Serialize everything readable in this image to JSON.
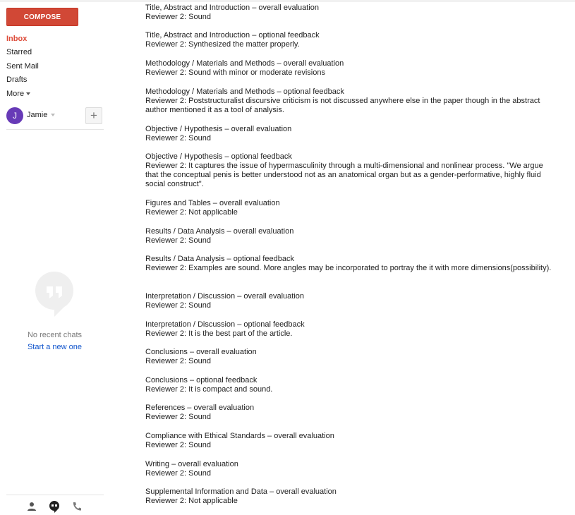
{
  "sidebar": {
    "compose_label": "COMPOSE",
    "nav": [
      {
        "label": "Inbox",
        "active": true
      },
      {
        "label": "Starred"
      },
      {
        "label": "Sent Mail"
      },
      {
        "label": "Drafts"
      },
      {
        "label": "More"
      }
    ],
    "user": {
      "initial": "J",
      "name": "Jamie",
      "add_symbol": "+"
    },
    "chats": {
      "empty_text": "No recent chats",
      "start_link": "Start a new one"
    },
    "bottom_icons": [
      "person-icon",
      "hangouts-icon",
      "phone-icon"
    ]
  },
  "colors": {
    "compose": "#d14836",
    "active_nav": "#dd4b39",
    "link": "#1155cc",
    "avatar": "#673ab7"
  },
  "message": {
    "sections": [
      {
        "title": "Title, Abstract and Introduction – overall evaluation",
        "body": "Reviewer 2: Sound"
      },
      {
        "title": "Title, Abstract and Introduction – optional feedback",
        "body": "Reviewer 2: Synthesized the matter properly."
      },
      {
        "title": "Methodology / Materials and Methods – overall evaluation",
        "body": "Reviewer 2: Sound with minor or moderate revisions"
      },
      {
        "title": "Methodology / Materials and Methods – optional feedback",
        "body": "Reviewer 2: Poststructuralist discursive criticism is not discussed anywhere else in the paper though in the abstract author mentioned it as a tool of analysis."
      },
      {
        "title": "Objective / Hypothesis – overall evaluation",
        "body": "Reviewer 2: Sound"
      },
      {
        "title": "Objective / Hypothesis – optional feedback",
        "body": "Reviewer 2: It captures the issue of hypermasculinity through a multi-dimensional and nonlinear process. \"We argue that the conceptual penis is better understood not as an anatomical organ but as a gender-performative, highly fluid social construct\"."
      },
      {
        "title": "Figures and Tables – overall evaluation",
        "body": "Reviewer 2: Not applicable"
      },
      {
        "title": "Results / Data Analysis – overall evaluation",
        "body": "Reviewer 2: Sound"
      },
      {
        "title": "Results / Data Analysis – optional feedback",
        "body": "Reviewer 2: Examples are sound. More angles may be incorporated to portray the it with more dimensions(possibility)."
      },
      {
        "title": "Interpretation / Discussion – overall evaluation",
        "body": "Reviewer 2: Sound"
      },
      {
        "title": "Interpretation / Discussion – optional feedback",
        "body": "Reviewer 2: It is the best part of the article."
      },
      {
        "title": "Conclusions – overall evaluation",
        "body": "Reviewer 2: Sound"
      },
      {
        "title": "Conclusions – optional feedback",
        "body": "Reviewer 2: It is compact and sound."
      },
      {
        "title": "References – overall evaluation",
        "body": "Reviewer 2: Sound"
      },
      {
        "title": "Compliance with Ethical Standards – overall evaluation",
        "body": "Reviewer 2: Sound"
      },
      {
        "title": "Writing – overall evaluation",
        "body": "Reviewer 2: Sound"
      },
      {
        "title": "Supplemental Information and Data – overall evaluation",
        "body": "Reviewer 2: Not applicable"
      }
    ]
  }
}
